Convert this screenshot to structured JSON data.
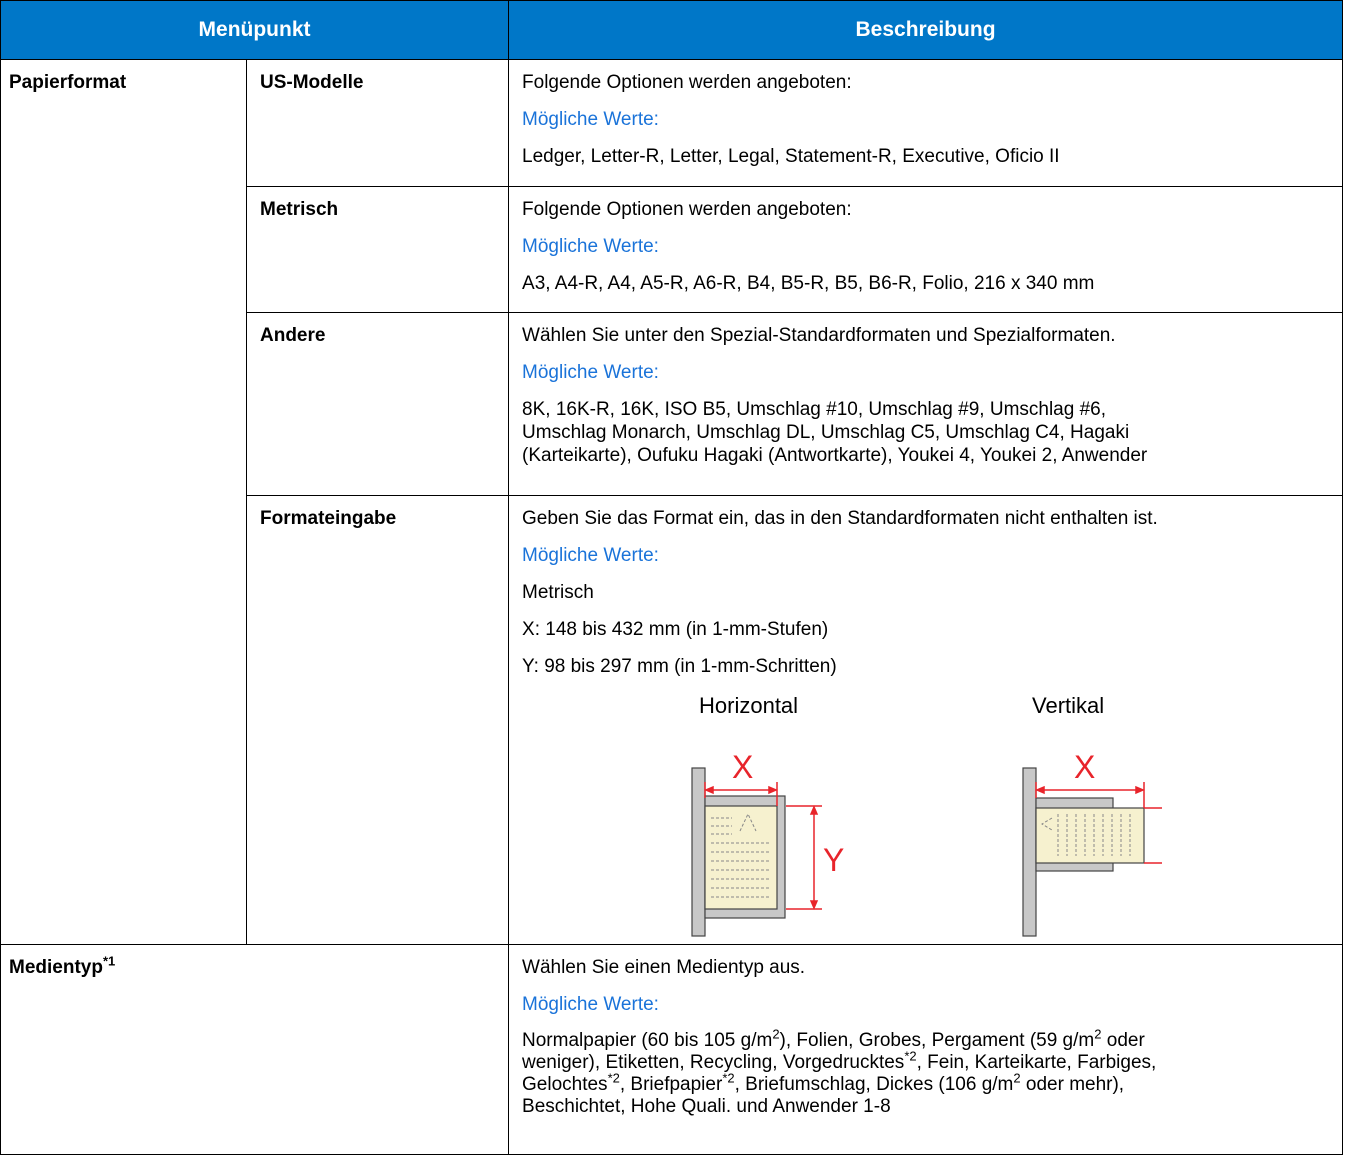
{
  "header": {
    "col_menu": "Menüpunkt",
    "col_desc": "Beschreibung"
  },
  "papierformat": {
    "label": "Papierformat",
    "us": {
      "label": "US-Modelle",
      "desc": "Folgende Optionen werden angeboten:",
      "values_label": "Mögliche Werte:",
      "values": "Ledger, Letter-R, Letter, Legal, Statement-R, Executive, Oficio II"
    },
    "metrisch": {
      "label": "Metrisch",
      "desc": "Folgende Optionen werden angeboten:",
      "values_label": "Mögliche Werte:",
      "values": "A3, A4-R, A4, A5-R, A6-R, B4, B5-R, B5, B6-R, Folio, 216 x 340 mm"
    },
    "andere": {
      "label": "Andere",
      "desc": "Wählen Sie unter den Spezial-Standardformaten und Spezialformaten.",
      "values_label": "Mögliche Werte:",
      "values_line1": "8K, 16K-R, 16K, ISO B5, Umschlag #10, Umschlag #9, Umschlag #6,",
      "values_line2": "Umschlag Monarch, Umschlag DL, Umschlag C5, Umschlag C4, Hagaki",
      "values_line3": "(Karteikarte), Oufuku Hagaki (Antwortkarte), Youkei 4, Youkei 2, Anwender"
    },
    "formateingabe": {
      "label": "Formateingabe",
      "desc": "Geben Sie das Format ein, das in den Standardformaten nicht enthalten ist.",
      "values_label": "Mögliche Werte:",
      "unit": "Metrisch",
      "x_range": "X: 148 bis 432 mm (in 1-mm-Stufen)",
      "y_range": "Y: 98 bis 297 mm (in 1-mm-Schritten)",
      "diagram": {
        "horizontal_label": "Horizontal",
        "vertical_label": "Vertikal",
        "x_marker": "X",
        "y_marker": "Y",
        "accent_color": "#e8242b",
        "paper_color": "#f6f1cf"
      }
    }
  },
  "medientyp": {
    "label": "Medientyp",
    "footnote": "*1",
    "desc": "Wählen Sie einen Medientyp aus.",
    "values_label": "Mögliche Werte:",
    "v1": "Normalpapier (60 bis 105 g/m",
    "v2": "), Folien, Grobes, Pergament (59 g/m",
    "v3": " oder",
    "v4": "weniger), Etiketten, Recycling, Vorgedrucktes",
    "v5": ", Fein, Karteikarte, Farbiges,",
    "v6": "Gelochtes",
    "v7": ", Briefpapier",
    "v8": ", Briefumschlag, Dickes (106 g/m",
    "v9": " oder mehr),",
    "v10": "Beschichtet, Hohe Quali. und Anwender 1-8",
    "sup_2": "2",
    "sup_star2": "*2"
  }
}
